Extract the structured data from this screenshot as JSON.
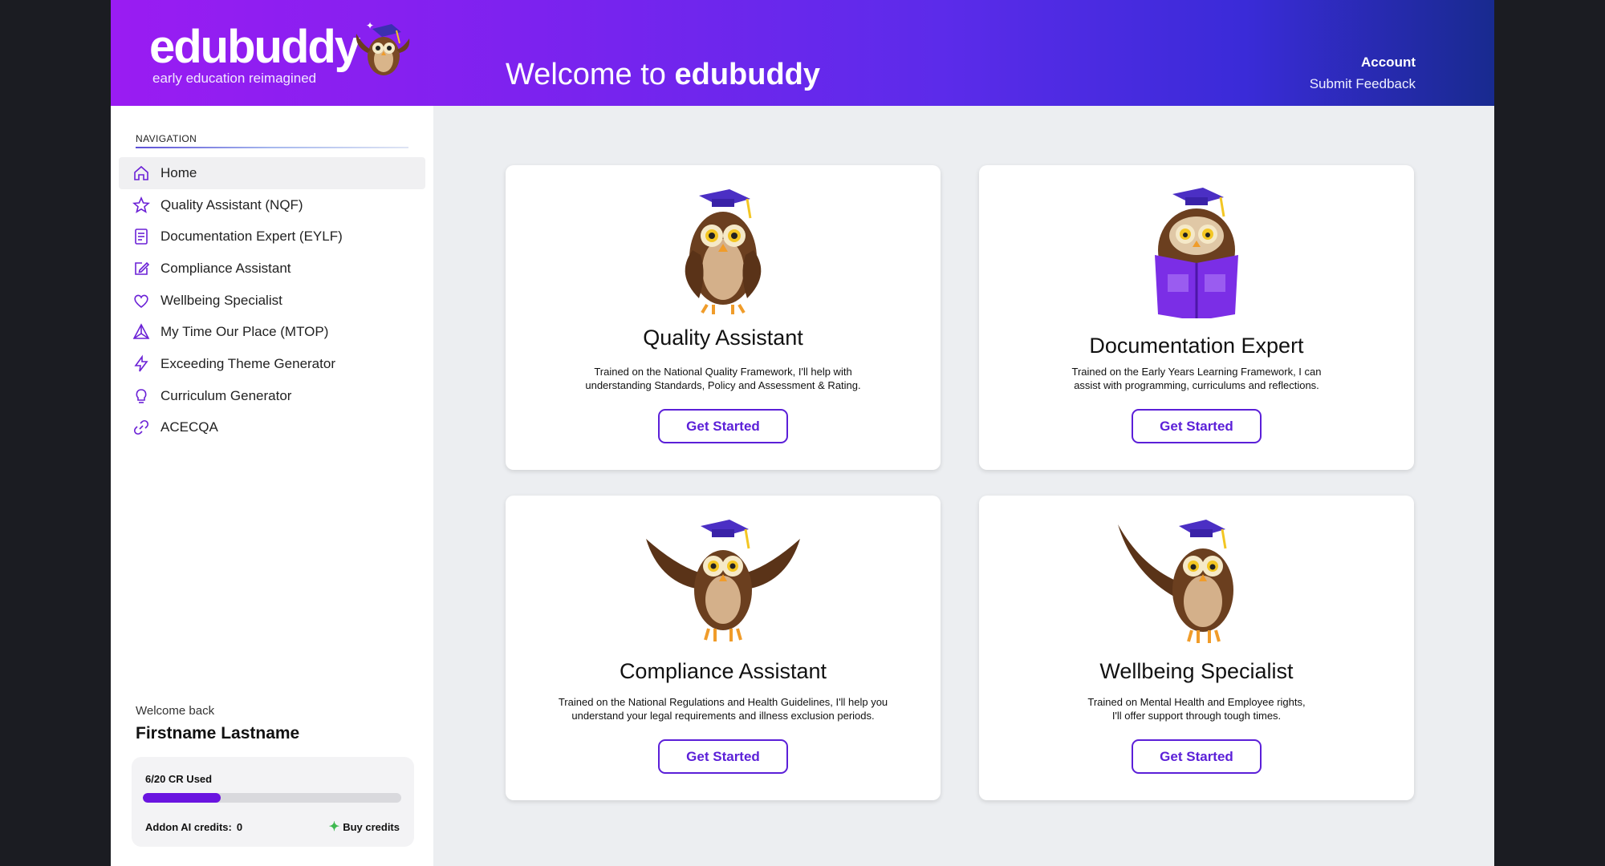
{
  "header": {
    "logo_text": "edubuddy",
    "logo_tagline": "early education reimagined",
    "welcome_prefix": "Welcome to ",
    "welcome_brand": "edubuddy",
    "account_link": "Account",
    "feedback_link": "Submit Feedback"
  },
  "sidebar": {
    "nav_title": "NAVIGATION",
    "items": [
      {
        "label": "Home",
        "icon": "home-icon"
      },
      {
        "label": "Quality Assistant (NQF)",
        "icon": "star-icon"
      },
      {
        "label": "Documentation Expert (EYLF)",
        "icon": "document-icon"
      },
      {
        "label": "Compliance Assistant",
        "icon": "edit-icon"
      },
      {
        "label": "Wellbeing Specialist",
        "icon": "heart-icon"
      },
      {
        "label": "My Time Our Place (MTOP)",
        "icon": "triangle-icon"
      },
      {
        "label": "Exceeding Theme Generator",
        "icon": "lightning-icon"
      },
      {
        "label": "Curriculum Generator",
        "icon": "lightbulb-icon"
      },
      {
        "label": "ACECQA",
        "icon": "link-icon"
      }
    ],
    "welcome_back": "Welcome back",
    "user_name": "Firstname Lastname",
    "credits": {
      "used_label": "6/20 CR Used",
      "used_fraction": 0.3,
      "addon_label": "Addon AI credits:",
      "addon_value": "0",
      "buy_label": "Buy credits"
    }
  },
  "cards": [
    {
      "title": "Quality Assistant",
      "desc_line1": "Trained on the National Quality Framework, I'll help with",
      "desc_line2": "understanding Standards, Policy and Assessment & Rating.",
      "button": "Get Started",
      "illustration": "owl-standing-illustration"
    },
    {
      "title": "Documentation Expert",
      "desc_line1": "Trained on the Early Years Learning Framework, I can",
      "desc_line2": "assist with programming, curriculums and reflections.",
      "button": "Get Started",
      "illustration": "owl-reading-illustration"
    },
    {
      "title": "Compliance Assistant",
      "desc_line1": "Trained on the National Regulations and Health Guidelines, I'll help you",
      "desc_line2": "understand your legal requirements and illness exclusion periods.",
      "button": "Get Started",
      "illustration": "owl-wings-up-illustration"
    },
    {
      "title": "Wellbeing Specialist",
      "desc_line1": "Trained on Mental Health and Employee rights,",
      "desc_line2": "I'll offer support through tough times.",
      "button": "Get Started",
      "illustration": "owl-waving-illustration"
    }
  ],
  "colors": {
    "accent": "#5b1fd8",
    "progress": "#6a14e0",
    "header_start": "#9a1cf2",
    "header_end": "#182a8f"
  }
}
